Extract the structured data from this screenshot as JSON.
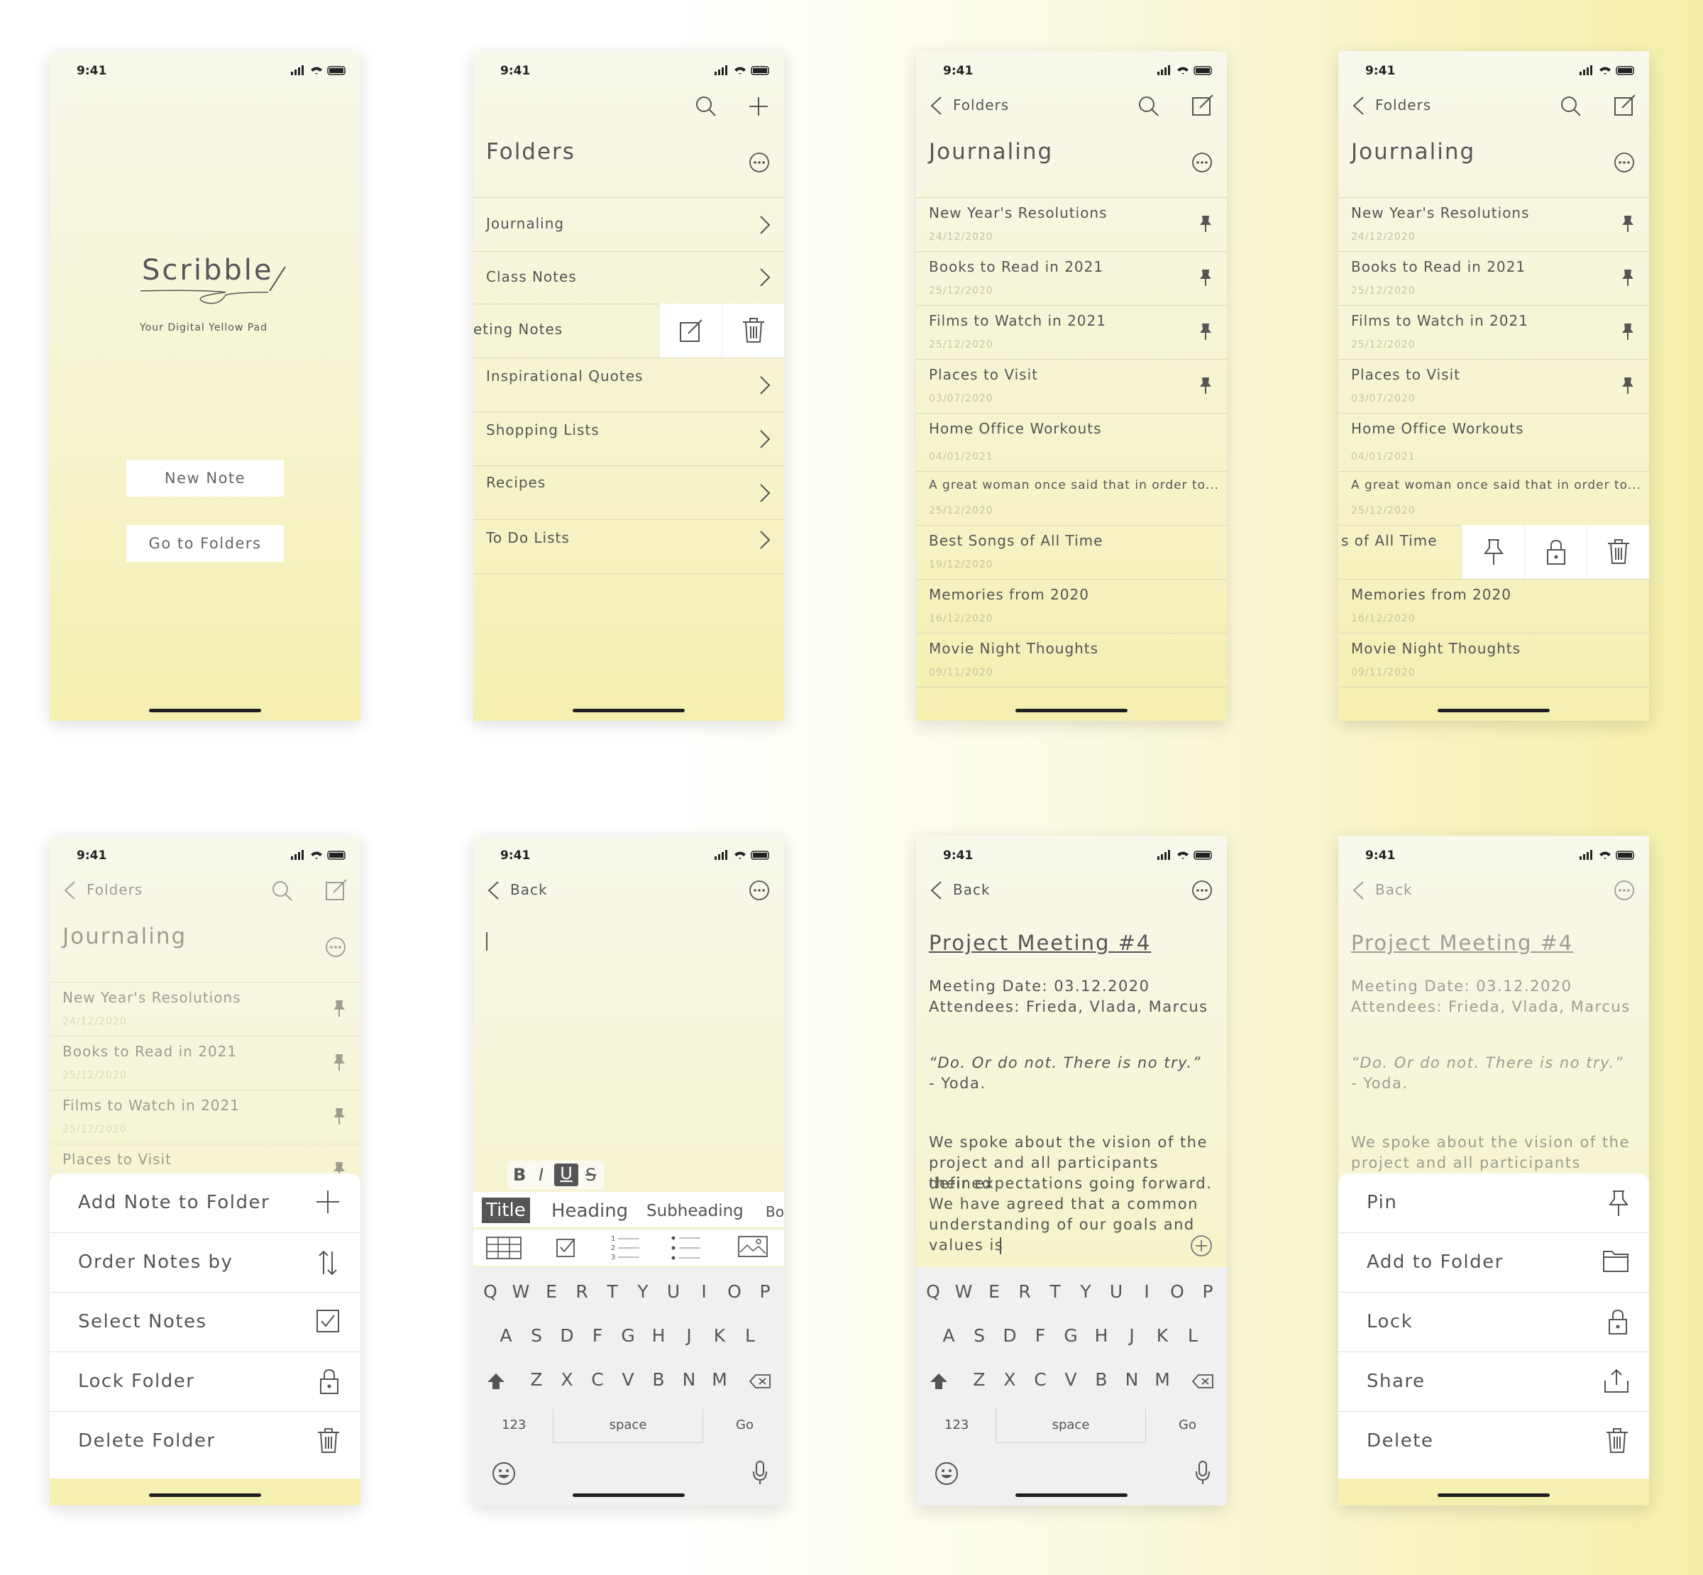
{
  "status_time": "9:41",
  "splash": {
    "logo": "Scribble",
    "tagline": "Your Digital Yellow Pad",
    "new_note": "New Note",
    "go_folders": "Go to Folders"
  },
  "folders": {
    "title": "Folders",
    "items": [
      "Journaling",
      "Class Notes",
      "eting Notes",
      "Inspirational Quotes",
      "Shopping Lists",
      "Recipes",
      "To Do Lists"
    ]
  },
  "journaling": {
    "back": "Folders",
    "title": "Journaling",
    "notes": [
      {
        "t": "New Year's Resolutions",
        "d": "24/12/2020",
        "pin": true
      },
      {
        "t": "Books to Read in 2021",
        "d": "25/12/2020",
        "pin": true
      },
      {
        "t": "Films to Watch in 2021",
        "d": "25/12/2020",
        "pin": true
      },
      {
        "t": "Places to Visit",
        "d": "03/07/2020",
        "pin": true
      },
      {
        "t": "Home Office Workouts",
        "d": "04/01/2021",
        "pin": false
      },
      {
        "t": "A great woman once said that in order to...",
        "d": "25/12/2020",
        "pin": false
      },
      {
        "t": "Best Songs of All Time",
        "d": "19/12/2020",
        "pin": false
      },
      {
        "t": "Memories from 2020",
        "d": "16/12/2020",
        "pin": false
      },
      {
        "t": "Movie Night Thoughts",
        "d": "09/11/2020",
        "pin": false
      }
    ],
    "swiped_label": "s of All Time"
  },
  "folder_sheet": [
    "Add Note to Folder",
    "Order Notes by",
    "Select Notes",
    "Lock Folder",
    "Delete Folder"
  ],
  "editor": {
    "back": "Back",
    "fmt": [
      "B",
      "I",
      "U",
      "S"
    ],
    "styles": [
      "Title",
      "Heading",
      "Subheading",
      "Bo"
    ]
  },
  "keyboard": {
    "row1": [
      "Q",
      "W",
      "E",
      "R",
      "T",
      "Y",
      "U",
      "I",
      "O",
      "P"
    ],
    "row2": [
      "A",
      "S",
      "D",
      "F",
      "G",
      "H",
      "J",
      "K",
      "L"
    ],
    "row3": [
      "Z",
      "X",
      "C",
      "V",
      "B",
      "N",
      "M"
    ],
    "num": "123",
    "space": "space",
    "go": "Go"
  },
  "project": {
    "title": "Project Meeting #4",
    "date": "Meeting Date: 03.12.2020",
    "att": "Attendees: Frieda, Vlada, Marcus",
    "quote": "“Do. Or do not. There is no try.”",
    "author": "- Yoda.",
    "body": [
      "We spoke about the vision of the",
      "project and all participants defined",
      "their expectations going forward.",
      "We have agreed that a common",
      "understanding of our goals and",
      "values is"
    ]
  },
  "note_sheet": [
    "Pin",
    "Add to Folder",
    "Lock",
    "Share",
    "Delete"
  ],
  "colors": {
    "bg_top": "#f8f8ec",
    "bg_bottom": "#f5efb0",
    "text": "#555555",
    "divider": "#dcd8b8"
  }
}
